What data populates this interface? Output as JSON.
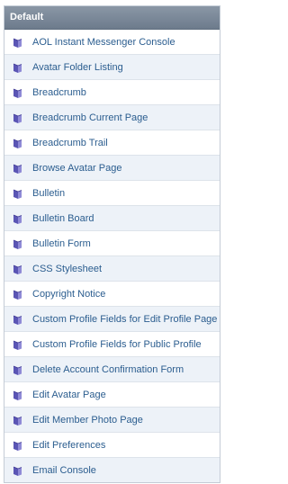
{
  "header": {
    "title": "Default"
  },
  "colors": {
    "link": "#2b5d8f",
    "icon": "#5a55b4",
    "stripe": "#edf2f8",
    "header": "#7a8797"
  },
  "icon_name": "template-book-icon",
  "items": [
    "AOL Instant Messenger Console",
    "Avatar Folder Listing",
    "Breadcrumb",
    "Breadcrumb Current Page",
    "Breadcrumb Trail",
    "Browse Avatar Page",
    "Bulletin",
    "Bulletin Board",
    "Bulletin Form",
    "CSS Stylesheet",
    "Copyright Notice",
    "Custom Profile Fields for Edit Profile Page",
    "Custom Profile Fields for Public Profile",
    "Delete Account Confirmation Form",
    "Edit Avatar Page",
    "Edit Member Photo Page",
    "Edit Preferences",
    "Email Console"
  ]
}
